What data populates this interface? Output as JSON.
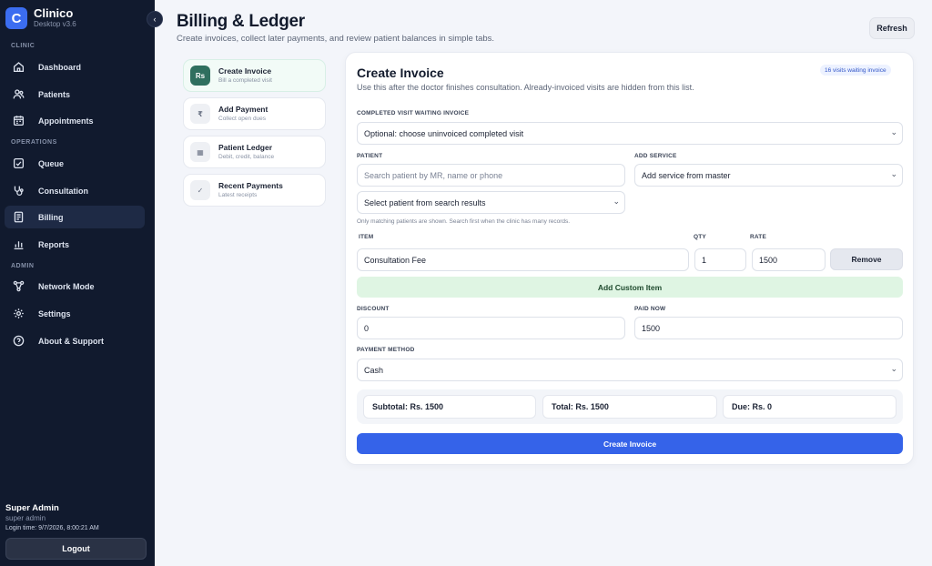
{
  "brand": {
    "logo_letter": "C",
    "name": "Clinico",
    "version": "Desktop v3.6"
  },
  "sidebar": {
    "collapse_icon": "chevron-left-icon",
    "sections": [
      "CLINIC",
      "OPERATIONS",
      "ADMIN"
    ],
    "items": [
      {
        "label": "Dashboard",
        "icon": "home-icon"
      },
      {
        "label": "Patients",
        "icon": "users-icon"
      },
      {
        "label": "Appointments",
        "icon": "calendar-icon"
      },
      {
        "label": "Queue",
        "icon": "check-square-icon"
      },
      {
        "label": "Consultation",
        "icon": "stethoscope-icon"
      },
      {
        "label": "Billing",
        "icon": "receipt-icon",
        "active": true
      },
      {
        "label": "Reports",
        "icon": "bar-chart-icon"
      },
      {
        "label": "Network Mode",
        "icon": "network-icon"
      },
      {
        "label": "Settings",
        "icon": "gear-icon"
      },
      {
        "label": "About & Support",
        "icon": "help-circle-icon"
      }
    ],
    "user": {
      "name": "Super Admin",
      "role": "super admin",
      "login_time": "Login time: 9/7/2026, 8:00:21 AM"
    },
    "logout_label": "Logout"
  },
  "header": {
    "title": "Billing & Ledger",
    "subtitle": "Create invoices, collect later payments, and review patient balances in simple tabs.",
    "refresh_label": "Refresh"
  },
  "tabs": [
    {
      "icon_text": "Rs",
      "title": "Create Invoice",
      "subtitle": "Bill a completed visit",
      "active": true
    },
    {
      "icon_text": "₹",
      "title": "Add Payment",
      "subtitle": "Collect open dues"
    },
    {
      "icon_text": "▦",
      "title": "Patient Ledger",
      "subtitle": "Debit, credit, balance"
    },
    {
      "icon_text": "✓",
      "title": "Recent Payments",
      "subtitle": "Latest receipts"
    }
  ],
  "form": {
    "title": "Create Invoice",
    "description": "Use this after the doctor finishes consultation. Already-invoiced visits are hidden from this list.",
    "badge": "16 visits waiting invoice",
    "visit_label": "COMPLETED VISIT WAITING INVOICE",
    "visit_value": "Optional: choose uninvoiced completed visit",
    "patient_label": "PATIENT",
    "patient_search_placeholder": "Search patient by MR, name or phone",
    "patient_select": "Select patient from search results",
    "patient_hint": "Only matching patients are shown. Search first when the clinic has many records.",
    "service_label": "ADD SERVICE",
    "service_value": "Add service from master",
    "item_header": "ITEM",
    "qty_header": "QTY",
    "rate_header": "RATE",
    "items": [
      {
        "name": "Consultation Fee",
        "qty": "1",
        "rate": "1500",
        "remove_label": "Remove"
      }
    ],
    "add_custom_label": "Add Custom Item",
    "discount_label": "DISCOUNT",
    "discount_value": "0",
    "paid_label": "PAID NOW",
    "paid_value": "1500",
    "payment_method_label": "PAYMENT METHOD",
    "payment_method_value": "Cash",
    "subtotal": "Subtotal: Rs. 1500",
    "total": "Total: Rs. 1500",
    "due": "Due: Rs. 0",
    "submit_label": "Create Invoice"
  },
  "colors": {
    "sidebar_bg": "#111a2e",
    "accent": "#3563e9",
    "active_tab_icon": "#2f6f5f",
    "custom_item_bg": "#dff5e3"
  }
}
